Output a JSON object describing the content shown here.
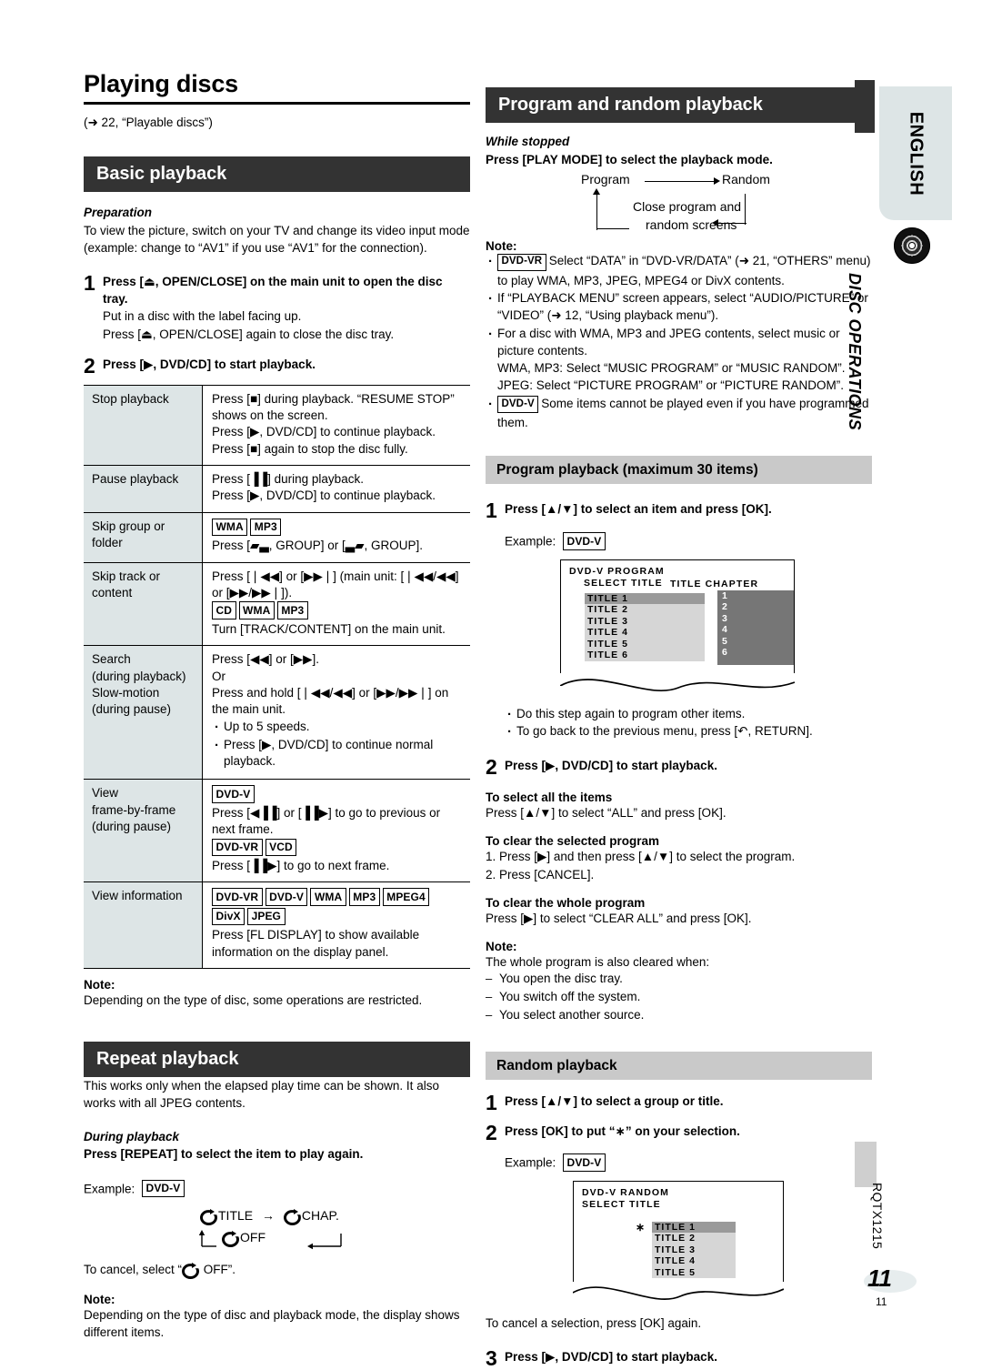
{
  "page": {
    "title": "Playing discs",
    "reference": "(➜ 22, “Playable discs”)",
    "number": "11",
    "number_small": "11",
    "doc_code": "RQTX1215"
  },
  "sidebar": {
    "language_tab": "ENGLISH",
    "section_tab": "DISC OPERATIONS",
    "disc_icon": "disc-icon"
  },
  "basic_playback": {
    "heading": "Basic playback",
    "preparation_label": "Preparation",
    "preparation_text": "To view the picture, switch on your TV and change its video input mode (example: change to “AV1” if you use “AV1” for the connection).",
    "step1": {
      "num": "1",
      "bold": "Press [⏏, OPEN/CLOSE] on the main unit to open the disc tray.",
      "line2": "Put in a disc with the label facing up.",
      "line3": "Press [⏏, OPEN/CLOSE] again to close the disc tray."
    },
    "step2": {
      "num": "2",
      "bold": "Press [▶, DVD/CD] to start playback."
    },
    "table": [
      {
        "key": "Stop playback",
        "lines": [
          "Press [■] during playback. “RESUME STOP” shows on the screen.",
          "Press [▶, DVD/CD] to continue playback.",
          "Press [■] again to stop the disc fully."
        ],
        "tags": []
      },
      {
        "key": "Pause playback",
        "lines": [
          "Press [▐▐] during playback.",
          "Press [▶, DVD/CD] to continue playback."
        ],
        "tags": []
      },
      {
        "key": "Skip group or folder",
        "tags": [
          "WMA",
          "MP3"
        ],
        "lines": [
          "Press [▰▃, GROUP] or [▃▰, GROUP]."
        ]
      },
      {
        "key": "Skip track or content",
        "lines": [
          "Press [❘◀◀] or [▶▶❘] (main unit: [❘◀◀/◀◀] or [▶▶/▶▶❘])."
        ],
        "tags2": [
          "CD",
          "WMA",
          "MP3"
        ],
        "lines2": [
          "Turn [TRACK/CONTENT] on the main unit."
        ]
      },
      {
        "key": "Search (during playback) Slow-motion (during pause)",
        "key_lines": [
          "Search",
          "(during playback)",
          "Slow-motion",
          "(during pause)"
        ],
        "lines": [
          "Press [◀◀] or [▶▶].",
          "Or",
          "Press and hold [❘◀◀/◀◀] or [▶▶/▶▶❘] on the main unit."
        ],
        "bullets": [
          "Up to 5 speeds.",
          "Press [▶, DVD/CD] to continue normal playback."
        ]
      },
      {
        "key_lines": [
          "View",
          "frame-by-frame",
          "(during pause)"
        ],
        "tags": [
          "DVD-V"
        ],
        "lines": [
          "Press [◀▐▐] or [▐▐▶] to go to previous or next frame."
        ],
        "tags2": [
          "DVD-VR",
          "VCD"
        ],
        "lines2": [
          "Press [▐▐▶] to go to next frame."
        ]
      },
      {
        "key_lines": [
          "View information"
        ],
        "tags": [
          "DVD-VR",
          "DVD-V",
          "WMA",
          "MP3",
          "MPEG4"
        ],
        "tags_row2": [
          "DivX",
          "JPEG"
        ],
        "lines": [
          "Press [FL DISPLAY] to show available information on the display panel."
        ]
      }
    ],
    "note_label": "Note:",
    "note_text": "Depending on the type of disc, some operations are restricted."
  },
  "repeat_playback": {
    "heading": "Repeat playback",
    "intro": "This works only when the elapsed play time can be shown. It also works with all JPEG contents.",
    "during_label": "During playback",
    "during_bold": "Press [REPEAT] to select the item to play again.",
    "example_label": "Example:",
    "example_tag": "DVD-V",
    "cycle": {
      "title": "TITLE",
      "chap": "CHAP.",
      "off": "OFF",
      "arrow": "→"
    },
    "cancel_text_pre": "To cancel, select “",
    "cancel_text_post": " OFF”.",
    "note_label": "Note:",
    "note_text": "Depending on the type of disc and playback mode, the display shows different items."
  },
  "program_random": {
    "heading": "Program and random playback",
    "while_stopped_label": "While stopped",
    "while_stopped_bold": "Press [PLAY MODE] to select the playback mode.",
    "flow": {
      "program": "Program",
      "random": "Random",
      "close_line1": "Close program and",
      "close_line2": "random screens"
    },
    "note_label": "Note:",
    "notes": [
      {
        "tag": "DVD-VR",
        "text": "Select “DATA” in “DVD-VR/DATA” (➜ 21, “OTHERS” menu) to play WMA, MP3, JPEG, MPEG4 or DivX contents."
      },
      {
        "tag": "",
        "text": "If “PLAYBACK MENU” screen appears, select “AUDIO/PICTURE” or “VIDEO” (➜ 12, “Using playback menu”)."
      },
      {
        "tag": "",
        "text": "For a disc with WMA, MP3 and JPEG contents, select music or picture contents.\nWMA, MP3: Select “MUSIC PROGRAM” or “MUSIC RANDOM”.\nJPEG: Select “PICTURE PROGRAM” or “PICTURE RANDOM”."
      },
      {
        "tag": "DVD-V",
        "text": "Some items cannot be played even if you have programmed them."
      }
    ]
  },
  "program_playback": {
    "heading": "Program playback (maximum 30 items)",
    "step1": {
      "num": "1",
      "bold": "Press [▲/▼] to select an item and press [OK]."
    },
    "example_label": "Example:",
    "example_tag": "DVD-V",
    "osd": {
      "title": "DVD-V PROGRAM",
      "subtitle": "SELECT  TITLE",
      "right_header": "TITLE CHAPTER",
      "left_rows": [
        "TITLE     1",
        "TITLE     2",
        "TITLE     3",
        "TITLE     4",
        "TITLE     5",
        "TITLE     6"
      ],
      "right_rows": [
        "1",
        "2",
        "3",
        "4",
        "5",
        "6"
      ],
      "selected_index": 0
    },
    "bullets": [
      "Do this step again to program other items.",
      "To go back to the previous menu, press [↶, RETURN]."
    ],
    "step2": {
      "num": "2",
      "bold": "Press [▶, DVD/CD] to start playback."
    },
    "select_all_label": "To select all the items",
    "select_all_text": "Press [▲/▼] to select “ALL” and press [OK].",
    "clear_selected_label": "To clear the selected program",
    "clear_selected_lines": [
      "1. Press [▶] and then press [▲/▼] to select the program.",
      "2. Press [CANCEL]."
    ],
    "clear_whole_label": "To clear the whole program",
    "clear_whole_text": "Press [▶] to select “CLEAR ALL” and press [OK].",
    "note_label": "Note:",
    "note_intro": "The whole program is also cleared when:",
    "note_items": [
      "You open the disc tray.",
      "You switch off the system.",
      "You select another source."
    ]
  },
  "random_playback": {
    "heading": "Random playback",
    "step1": {
      "num": "1",
      "bold": "Press [▲/▼] to select a group or title."
    },
    "step2": {
      "num": "2",
      "bold": "Press [OK] to put “∗” on your selection."
    },
    "example_label": "Example:",
    "example_tag": "DVD-V",
    "osd": {
      "title": "DVD-V RANDOM",
      "subtitle": "SELECT   TITLE",
      "star": "∗",
      "rows": [
        "TITLE     1",
        "TITLE     2",
        "TITLE     3",
        "TITLE     4",
        "TITLE     5"
      ],
      "selected_index": 0
    },
    "cancel_text": "To cancel a selection, press [OK] again.",
    "step3": {
      "num": "3",
      "bold": "Press [▶, DVD/CD] to start playback."
    }
  },
  "colors": {
    "bar_dark": "#333333",
    "bar_grey": "#c9c9c9",
    "table_key_bg": "#dde5e6",
    "sidebar_bg": "#dde5e6",
    "osd_selected": "#9a9a9a",
    "osd_row": "#d6d6d6",
    "osd_right_panel": "#767676"
  }
}
